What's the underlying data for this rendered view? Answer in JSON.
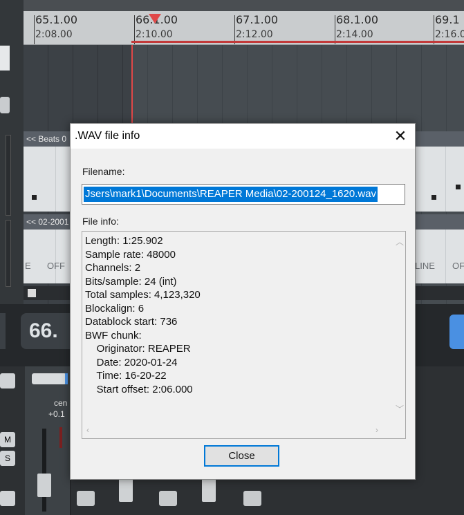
{
  "ruler": {
    "marks": [
      {
        "measure": "65.1.00",
        "time": "2:08.00"
      },
      {
        "measure": "66.1.00",
        "time": "2:10.00"
      },
      {
        "measure": "67.1.00",
        "time": "2:12.00"
      },
      {
        "measure": "68.1.00",
        "time": "2:14.00"
      },
      {
        "measure": "69.1",
        "time": "2:16.0"
      }
    ]
  },
  "tracks": [
    {
      "label": "<< Beats 0"
    },
    {
      "label": "<< 02-2001"
    }
  ],
  "item2_texts": [
    "E",
    "OFF",
    "LINE",
    "OF"
  ],
  "transport": {
    "time": "66."
  },
  "mixer": {
    "pan_label": "cen",
    "pan_value": "+0.1"
  },
  "dialog": {
    "title": ".WAV file info",
    "filename_label": "Filename:",
    "filename_value": "Jsers\\mark1\\Documents\\REAPER Media\\02-200124_1620.wav",
    "fileinfo_label": "File info:",
    "info_lines": [
      "Length: 1:25.902",
      "Sample rate: 48000",
      "Channels: 2",
      "Bits/sample: 24 (int)",
      "Total samples: 4,123,320",
      "Blockalign: 6",
      "Datablock start: 736",
      "BWF chunk:",
      "    Originator: REAPER",
      "    Date: 2020-01-24",
      "    Time: 16-20-22",
      "    Start offset: 2:06.000"
    ],
    "close_label": "Close"
  },
  "colors": {
    "accent": "#0078d7",
    "playhead": "#e04848"
  }
}
